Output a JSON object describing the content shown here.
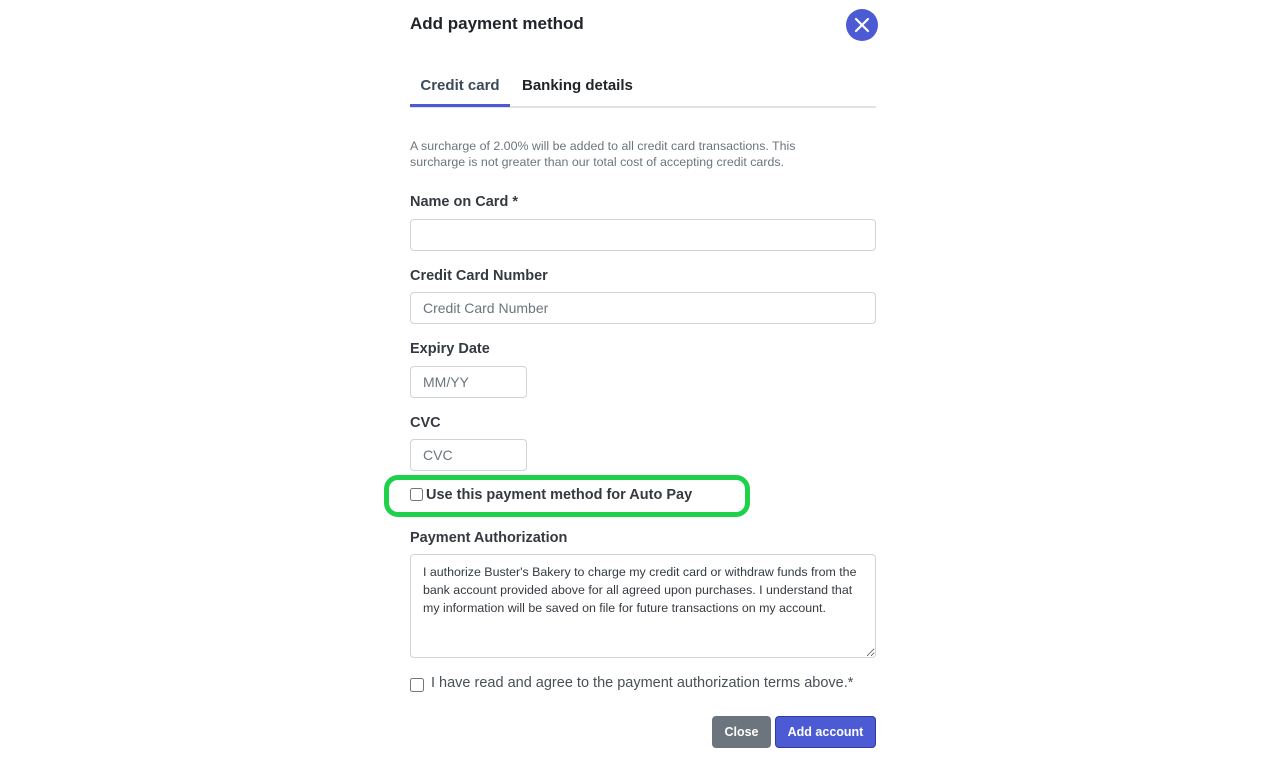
{
  "modal": {
    "title": "Add payment method",
    "close_icon": "close-icon"
  },
  "tabs": [
    {
      "label": "Credit card",
      "active": true
    },
    {
      "label": "Banking details",
      "active": false
    }
  ],
  "notice": "A surcharge of 2.00% will be added to all credit card transactions. This surcharge is not greater than our total cost of accepting credit cards.",
  "fields": {
    "name_on_card": {
      "label": "Name on Card *",
      "value": "",
      "placeholder": ""
    },
    "card_number": {
      "label": "Credit Card Number",
      "value": "",
      "placeholder": "Credit Card Number"
    },
    "expiry": {
      "label": "Expiry Date",
      "value": "",
      "placeholder": "MM/YY"
    },
    "cvc": {
      "label": "CVC",
      "value": "",
      "placeholder": "CVC"
    }
  },
  "autopay": {
    "label": "Use this payment method for Auto Pay",
    "checked": false,
    "highlight_color": "#1fd14a"
  },
  "authorization": {
    "label": "Payment Authorization",
    "text": "I authorize Buster's Bakery to charge my credit card or withdraw funds from the bank account provided above for all agreed upon purchases. I understand that my information will be saved on file for future transactions on my account."
  },
  "agree": {
    "label": "I have read and agree to the payment authorization terms above.*",
    "checked": false
  },
  "buttons": {
    "close_label": "Close",
    "add_label": "Add account"
  },
  "colors": {
    "accent": "#4c5bd4",
    "secondary": "#6c757d"
  }
}
